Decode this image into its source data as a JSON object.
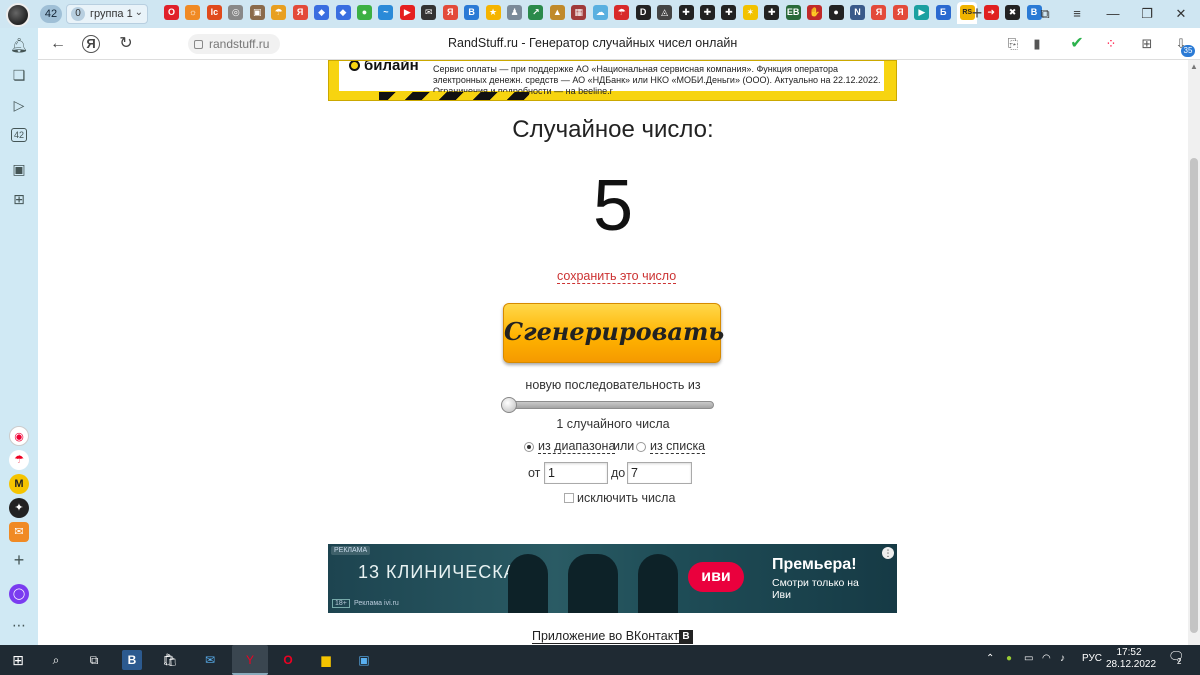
{
  "browser": {
    "tab_count": "42",
    "group": {
      "count": "0",
      "label": "группа 1"
    },
    "page_title": "RandStuff.ru - Генератор случайных чисел онлайн",
    "url": "randstuff.ru",
    "downloads_badge": "35",
    "tab_favicons": [
      {
        "name": "opera-tab",
        "color": "#e0202a",
        "glyph": "О"
      },
      {
        "name": "sun-tab",
        "color": "#f08a24",
        "glyph": "☼"
      },
      {
        "name": "lc-tab",
        "color": "#e04a1c",
        "glyph": "lc"
      },
      {
        "name": "globe-tab",
        "color": "#888",
        "glyph": "◎"
      },
      {
        "name": "box-tab",
        "color": "#8a6a4a",
        "glyph": "▣"
      },
      {
        "name": "umbrella-tab",
        "color": "#e8a020",
        "glyph": "☂"
      },
      {
        "name": "yandex-tab",
        "color": "#e34b3a",
        "glyph": "Я"
      },
      {
        "name": "cube-tab",
        "color": "#3a6ee0",
        "glyph": "◆"
      },
      {
        "name": "cube2-tab",
        "color": "#3a6ee0",
        "glyph": "◆"
      },
      {
        "name": "green-tab",
        "color": "#3cb043",
        "glyph": "●"
      },
      {
        "name": "wave-tab",
        "color": "#2a8ad8",
        "glyph": "~"
      },
      {
        "name": "youtube-tab",
        "color": "#e52020",
        "glyph": "▶"
      },
      {
        "name": "mail-tab",
        "color": "#333",
        "glyph": "✉"
      },
      {
        "name": "yandex2-tab",
        "color": "#e34b3a",
        "glyph": "Я"
      },
      {
        "name": "vk-tab",
        "color": "#2a7ad5",
        "glyph": "В"
      },
      {
        "name": "star-tab",
        "color": "#f5b400",
        "glyph": "★"
      },
      {
        "name": "person-tab",
        "color": "#7a8a99",
        "glyph": "♟"
      },
      {
        "name": "chart-tab",
        "color": "#2a8a4a",
        "glyph": "↗"
      },
      {
        "name": "photo-tab",
        "color": "#c08a2a",
        "glyph": "▲"
      },
      {
        "name": "image-tab",
        "color": "#a03a3a",
        "glyph": "▦"
      },
      {
        "name": "cloud-tab",
        "color": "#5ab0e0",
        "glyph": "☁"
      },
      {
        "name": "red-tab",
        "color": "#d82a2a",
        "glyph": "☂"
      },
      {
        "name": "d-tab",
        "color": "#222",
        "glyph": "D"
      },
      {
        "name": "arrow-tab",
        "color": "#444",
        "glyph": "◬"
      },
      {
        "name": "plus-tab",
        "color": "#222",
        "glyph": "✚"
      },
      {
        "name": "plus2-tab",
        "color": "#222",
        "glyph": "✚"
      },
      {
        "name": "plus3-tab",
        "color": "#222",
        "glyph": "✚"
      },
      {
        "name": "sparkle-tab",
        "color": "#f2c200",
        "glyph": "✶"
      },
      {
        "name": "plus4-tab",
        "color": "#222",
        "glyph": "✚"
      },
      {
        "name": "eb-tab",
        "color": "#2a6a3a",
        "glyph": "EB"
      },
      {
        "name": "hand-tab",
        "color": "#c02a2a",
        "glyph": "✋"
      },
      {
        "name": "circle-tab",
        "color": "#222",
        "glyph": "●"
      },
      {
        "name": "n-tab",
        "color": "#3a5a8a",
        "glyph": "N"
      },
      {
        "name": "yandex3-tab",
        "color": "#e34b3a",
        "glyph": "Я"
      },
      {
        "name": "yandex4-tab",
        "color": "#e34b3a",
        "glyph": "Я"
      },
      {
        "name": "play-tab",
        "color": "#1aa0a0",
        "glyph": "▶"
      },
      {
        "name": "b-tab",
        "color": "#2a6ad0",
        "glyph": "Б"
      },
      {
        "name": "randstuff-tab",
        "color": "#f0b400",
        "glyph": "RS",
        "active": true
      },
      {
        "name": "red-arrow-tab",
        "color": "#e02020",
        "glyph": "➜"
      },
      {
        "name": "x-tab",
        "color": "#222",
        "glyph": "✖"
      },
      {
        "name": "vk2-tab",
        "color": "#2a7ad5",
        "glyph": "В"
      }
    ]
  },
  "ad_top": {
    "brand": "билайн",
    "legal": "Сервис оплаты — при поддержке АО «Национальная сервисная компания». Функция оператора электронных денежн. средств — АО «НДБанк» или НКО «МОБИ.Деньги» (ООО). Актуально на 22.12.2022. Ограничения и подробности — на beeline.r"
  },
  "result": {
    "title": "Случайное число:",
    "number": "5",
    "save_link": "сохранить это число"
  },
  "generate_button": "Сгенерировать",
  "sequence": {
    "label": "новую последовательность из",
    "slider_value": 1,
    "count_label": "1 случайного числа"
  },
  "mode": {
    "range_label": "из диапазона",
    "or": "или",
    "list_label": "из списка",
    "selected": "range"
  },
  "range": {
    "from_label": "от",
    "from_value": "1",
    "to_label": "до",
    "to_value": "7"
  },
  "exclude_label": "исключить числа",
  "ad_bottom": {
    "tag": "РЕКЛАМА",
    "show_title": "13 КЛИНИЧЕСКАЯ",
    "brand": "иви",
    "headline": "Премьера!",
    "subline": "Смотри только на Иви",
    "age": "18+",
    "source": "Реклама ivi.ru"
  },
  "vk_link": "Приложение во ВКонтакте",
  "vk_icon_glyph": "В",
  "taskbar": {
    "lang": "РУС",
    "time": "17:52",
    "date": "28.12.2022",
    "notifications": "2"
  }
}
